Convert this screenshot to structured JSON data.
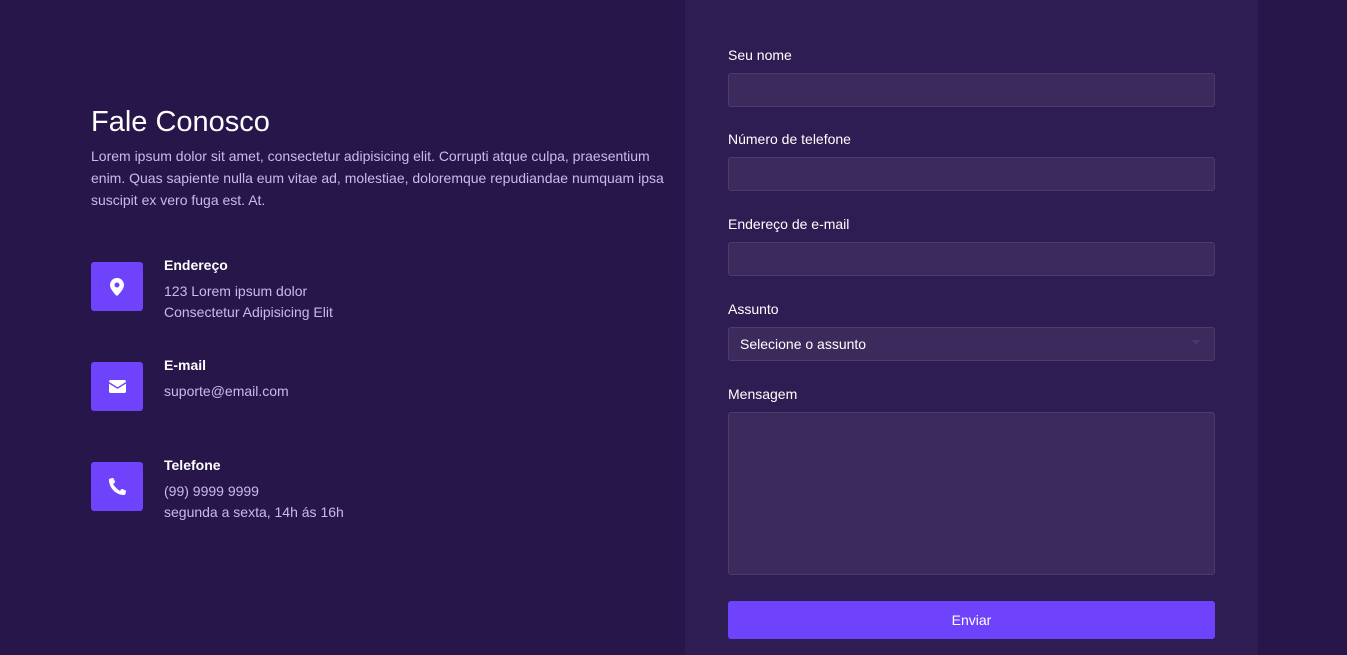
{
  "contact": {
    "title": "Fale Conosco",
    "description": "Lorem ipsum dolor sit amet, consectetur adipisicing elit. Corrupti atque culpa, praesentium enim. Quas sapiente nulla eum vitae ad, molestiae, doloremque repudiandae numquam ipsa suscipit ex vero fuga est. At.",
    "items": [
      {
        "icon": "map-pin-icon",
        "title": "Endereço",
        "lines": [
          "123 Lorem ipsum dolor",
          "Consectetur Adipisicing Elit"
        ]
      },
      {
        "icon": "envelope-icon",
        "title": "E-mail",
        "lines": [
          "suporte@email.com"
        ]
      },
      {
        "icon": "phone-icon",
        "title": "Telefone",
        "lines": [
          "(99) 9999 9999",
          "segunda a sexta, 14h ás 16h"
        ]
      }
    ]
  },
  "form": {
    "name_label": "Seu nome",
    "name_value": "",
    "phone_label": "Número de telefone",
    "phone_value": "",
    "email_label": "Endereço de e-mail",
    "email_value": "",
    "subject_label": "Assunto",
    "subject_selected": "Selecione o assunto",
    "message_label": "Mensagem",
    "message_value": "",
    "submit_label": "Enviar"
  },
  "colors": {
    "background": "#26164a",
    "panel": "#2e1d52",
    "input": "#3c2a5c",
    "accent": "#6f42fb",
    "muted_text": "#c9b9ec"
  }
}
